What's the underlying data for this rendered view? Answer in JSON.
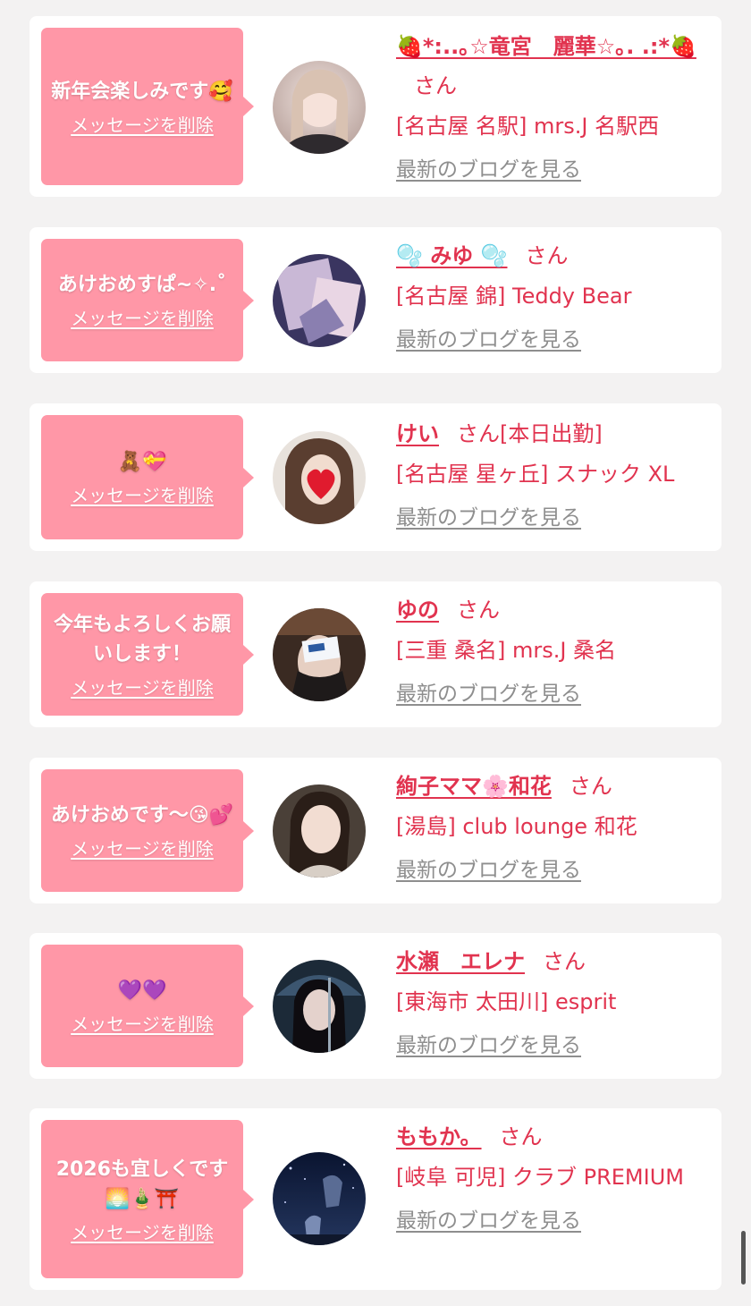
{
  "colors": {
    "page_bg": "#f3f2f2",
    "bubble_bg": "#ff97a7",
    "accent": "#e1334f",
    "link_gray": "#8e8e8e"
  },
  "messages": [
    {
      "bubble_text": "新年会楽しみです🥰",
      "delete_label": "メッセージを削除",
      "name": "🍓*:..｡☆竜宮　麗華☆｡. .:*🍓",
      "honorific": "さん",
      "status": "",
      "shop": "[名古屋 名駅] mrs.J 名駅西",
      "blog_link": "最新のブログを見る",
      "avatar_icon": "avatar-photo"
    },
    {
      "bubble_text": "あけおめすぱ~✧.˚",
      "delete_label": "メッセージを削除",
      "name": "🫧 みゆ 🫧",
      "honorific": "さん",
      "status": "",
      "shop": "[名古屋 錦] Teddy Bear",
      "blog_link": "最新のブログを見る",
      "avatar_icon": "avatar-photo"
    },
    {
      "bubble_text": "🧸💝",
      "delete_label": "メッセージを削除",
      "name": "けい",
      "honorific": "さん",
      "status": "[本日出勤]",
      "shop": "[名古屋 星ヶ丘] スナック XL",
      "blog_link": "最新のブログを見る",
      "avatar_icon": "avatar-photo"
    },
    {
      "bubble_text": "今年もよろしくお願いします！",
      "delete_label": "メッセージを削除",
      "name": "ゆの",
      "honorific": "さん",
      "status": "",
      "shop": "[三重 桑名] mrs.J 桑名",
      "blog_link": "最新のブログを見る",
      "avatar_icon": "avatar-photo"
    },
    {
      "bubble_text": "あけおめです〜😘💕",
      "delete_label": "メッセージを削除",
      "name": "絢子ママ🌸和花",
      "honorific": "さん",
      "status": "",
      "shop": "[湯島] club lounge 和花",
      "blog_link": "最新のブログを見る",
      "avatar_icon": "avatar-photo"
    },
    {
      "bubble_text": "💜💜",
      "delete_label": "メッセージを削除",
      "name": "水瀬　エレナ",
      "honorific": "さん",
      "status": "",
      "shop": "[東海市 太田川] esprit",
      "blog_link": "最新のブログを見る",
      "avatar_icon": "avatar-photo"
    },
    {
      "bubble_text": "2026も宜しくです🌅🎍⛩️",
      "delete_label": "メッセージを削除",
      "name": "ももか。",
      "honorific": "さん",
      "status": "",
      "shop": "[岐阜 可児] クラブ PREMIUM",
      "blog_link": "最新のブログを見る",
      "avatar_icon": "avatar-photo"
    }
  ]
}
